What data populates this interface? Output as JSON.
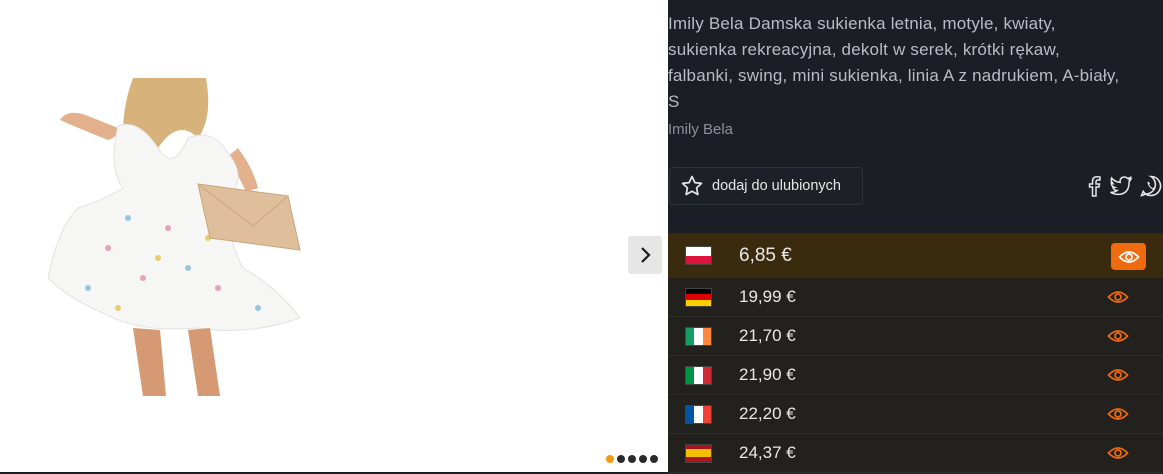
{
  "product": {
    "title": "Imily Bela Damska sukienka letnia, motyle, kwiaty, sukienka rekreacyjna, dekolt w serek, krótki rękaw, falbanki, swing, mini sukienka, linia A z nadrukiem, A-biały, S",
    "brand": "Imily Bela"
  },
  "gallery": {
    "image_icon": "white-summer-dress-photo",
    "next_icon": "chevron-right-icon",
    "dots_count": 5,
    "active_dot": 0
  },
  "favorite": {
    "label": "dodaj do ulubionych",
    "icon": "star-outline-icon"
  },
  "social": [
    "facebook-icon",
    "twitter-icon",
    "whatsapp-icon"
  ],
  "colors": {
    "accent": "#f06a0f",
    "highlight_row": "#3a2a0e",
    "panel_bg": "#1b1e24"
  },
  "prices": [
    {
      "country": "PL",
      "flag": "poland-flag",
      "price": "6,85 €",
      "best": true
    },
    {
      "country": "DE",
      "flag": "germany-flag",
      "price": "19,99 €",
      "best": false
    },
    {
      "country": "IE",
      "flag": "ireland-flag",
      "price": "21,70 €",
      "best": false
    },
    {
      "country": "IT",
      "flag": "italy-flag",
      "price": "21,90 €",
      "best": false
    },
    {
      "country": "FR",
      "flag": "france-flag",
      "price": "22,20 €",
      "best": false
    },
    {
      "country": "ES",
      "flag": "spain-flag",
      "price": "24,37 €",
      "best": false
    }
  ]
}
